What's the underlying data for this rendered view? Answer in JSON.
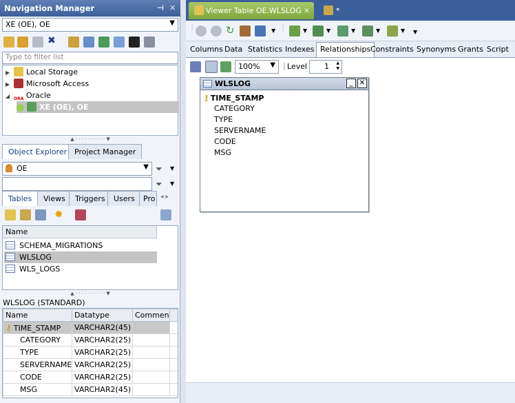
{
  "nav": {
    "title": "Navigation Manager",
    "connection": "XE (OE), OE",
    "filter_placeholder": "Type to filter list",
    "tree": {
      "local_storage": "Local Storage",
      "ms_access": "Microsoft Access",
      "oracle": "Oracle",
      "oracle_logo": "ORA",
      "xe": "XE (OE), OE"
    }
  },
  "explorer": {
    "tabs": [
      "Object Explorer",
      "Project Manager"
    ],
    "schema": "OE",
    "object_tabs": [
      "Tables",
      "Views",
      "Triggers",
      "Users",
      "Pro"
    ],
    "list_header": "Name",
    "tables": [
      "SCHEMA_MIGRATIONS",
      "WLSLOG",
      "WLS_LOGS"
    ],
    "details_title": "WLSLOG (STANDARD)",
    "columns_header": [
      "Name",
      "Datatype",
      "Comment"
    ],
    "columns": [
      {
        "name": "TIME_STAMP",
        "type": "VARCHAR2(45)",
        "comment": ""
      },
      {
        "name": "CATEGORY",
        "type": "VARCHAR2(25)",
        "comment": ""
      },
      {
        "name": "TYPE",
        "type": "VARCHAR2(25)",
        "comment": ""
      },
      {
        "name": "SERVERNAME",
        "type": "VARCHAR2(25)",
        "comment": ""
      },
      {
        "name": "CODE",
        "type": "VARCHAR2(25)",
        "comment": ""
      },
      {
        "name": "MSG",
        "type": "VARCHAR2(45)",
        "comment": ""
      }
    ]
  },
  "viewer": {
    "doc_tab": "Viewer Table OE.WLSLOG",
    "second_tab": "*",
    "sub_tabs": [
      "Columns",
      "Data",
      "Statistics",
      "Indexes",
      "Relationships",
      "Constraints",
      "Synonyms",
      "Grants",
      "Script"
    ],
    "active_sub_tab": "Relationships",
    "zoom": "100%",
    "level_label": "Level",
    "level_value": "1",
    "entity": {
      "title": "WLSLOG",
      "key_field": "TIME_STAMP",
      "fields": [
        "CATEGORY",
        "TYPE",
        "SERVERNAME",
        "CODE",
        "MSG"
      ]
    }
  },
  "colors": {
    "title_bar": "#3c5f9a",
    "selection": "#c4c4c4",
    "doc_tab_bg": "#7fa83c"
  }
}
